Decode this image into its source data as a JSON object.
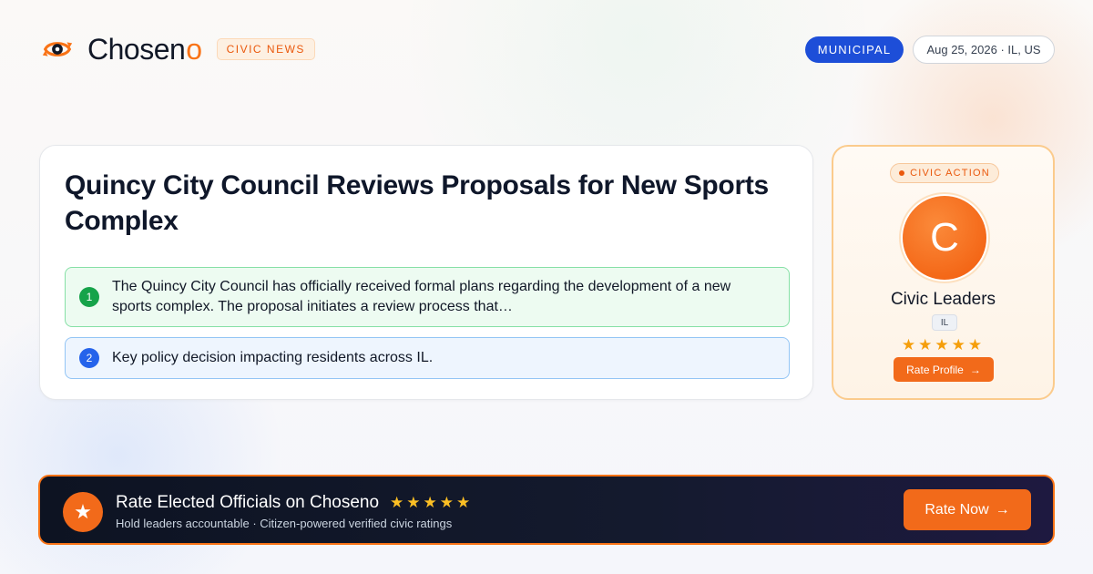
{
  "brand": {
    "name": "Chosen",
    "name_accent": "o",
    "section_badge": "CIVIC NEWS"
  },
  "header": {
    "category_badge": "MUNICIPAL",
    "date_location": "Aug 25, 2026 · IL, US"
  },
  "article": {
    "headline": "Quincy City Council Reviews Proposals for New Sports Complex",
    "points": [
      {
        "number": "1",
        "text": "The Quincy City Council has officially received formal plans regarding the development of a new sports complex. The proposal initiates a review process that…"
      },
      {
        "number": "2",
        "text": "Key policy decision impacting residents across IL."
      }
    ]
  },
  "side_card": {
    "badge": "CIVIC ACTION",
    "avatar_initial": "C",
    "name": "Civic Leaders",
    "state": "IL",
    "stars": "★★★★★",
    "rating": 5,
    "button_label": "Rate Profile",
    "button_arrow": "→"
  },
  "banner": {
    "icon": "star-icon",
    "title": "Rate Elected Officials on Choseno",
    "stars": "★★★★★",
    "subtitle": "Hold leaders accountable · Citizen-powered verified civic ratings",
    "button_label": "Rate Now",
    "button_arrow": "→"
  },
  "colors": {
    "accent": "#f97316",
    "municipal": "#1d4ed8",
    "point_1": "#16a34a",
    "point_2": "#2563eb",
    "banner_bg": "#0d1322"
  }
}
